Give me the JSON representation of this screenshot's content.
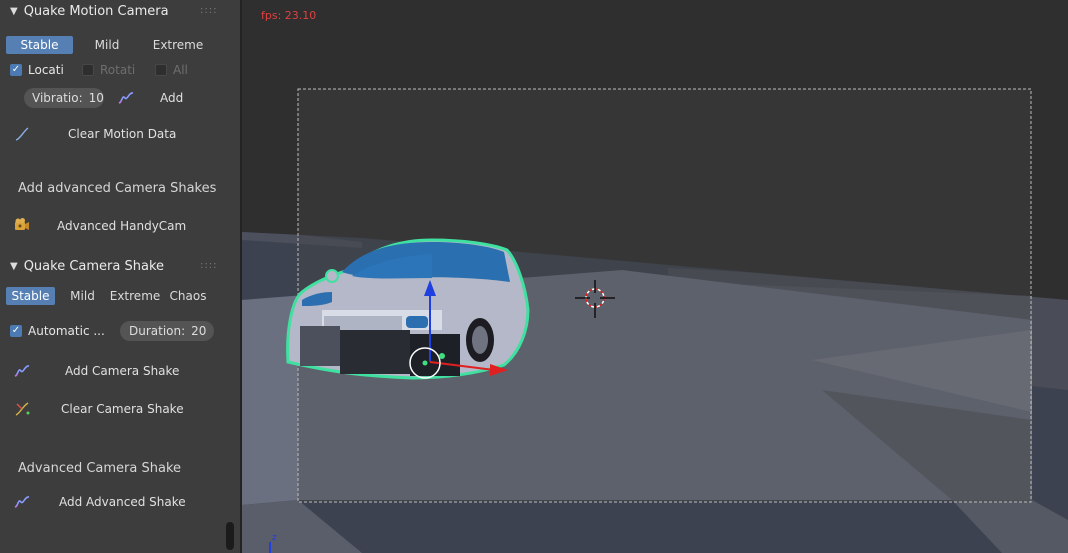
{
  "motion_camera": {
    "title": "Quake Motion Camera",
    "presets": [
      "Stable",
      "Mild",
      "Extreme"
    ],
    "active_preset": "Stable",
    "checkboxes": [
      {
        "label": "Locati",
        "checked": true
      },
      {
        "label": "Rotati",
        "checked": false
      },
      {
        "label": "All",
        "checked": false
      }
    ],
    "vibration_label": "Vibratio:",
    "vibration_value": "10",
    "add_label": "Add",
    "clear_label": "Clear Motion Data"
  },
  "advanced_shakes": {
    "title": "Add advanced Camera Shakes",
    "handycam_label": "Advanced HandyCam"
  },
  "camera_shake": {
    "title": "Quake Camera Shake",
    "presets": [
      "Stable",
      "Mild",
      "Extreme",
      "Chaos"
    ],
    "active_preset": "Stable",
    "automatic_label": "Automatic ...",
    "automatic_checked": true,
    "duration_label": "Duration:",
    "duration_value": "20",
    "add_label": "Add Camera Shake",
    "clear_label": "Clear Camera Shake"
  },
  "advanced_shake": {
    "title": "Advanced Camera Shake",
    "add_label": "Add Advanced Shake"
  },
  "viewport": {
    "fps_text": "fps: 23.10",
    "axis_label": "z"
  },
  "colors": {
    "accent": "#5680b4",
    "outline": "#3fe0a0",
    "fps": "#e04040",
    "z_axis": "#1f3fe0",
    "x_axis": "#e02020"
  }
}
